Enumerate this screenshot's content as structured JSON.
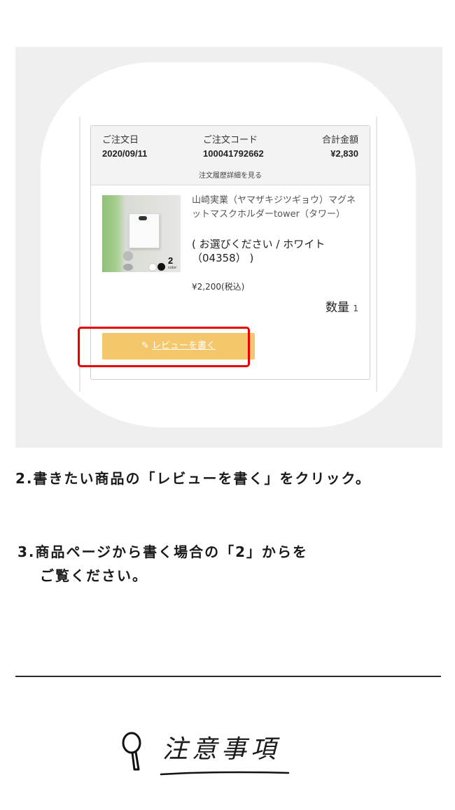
{
  "order": {
    "date_label": "ご注文日",
    "date": "2020/09/11",
    "code_label": "ご注文コード",
    "code": "100041792662",
    "total_label": "合計金額",
    "total": "¥2,830",
    "detail_link": "注文履歴詳細を見る"
  },
  "product": {
    "name": "山崎実業（ヤマザキジツギョウ）マグネットマスクホルダーtower（タワー）",
    "option": "( お選びください / ホワイト（04358） )",
    "price": "¥2,200(税込)",
    "qty_label": "数量",
    "qty": "1",
    "thumb_count": "2",
    "thumb_count_label": "color"
  },
  "review_button": {
    "label": "レビューを書く",
    "icon": "pencil-icon"
  },
  "steps": {
    "step2": "2.書きたい商品の「レビューを書く」をクリック。",
    "step3_line1": "3.商品ページから書く場合の「2」からを",
    "step3_line2": "ご覧ください。"
  },
  "notes": {
    "title": "注意事項",
    "icon": "magnifier-icon"
  },
  "colors": {
    "button": "#f5c76c",
    "highlight": "#e60000",
    "panel_bg": "#efefef"
  }
}
